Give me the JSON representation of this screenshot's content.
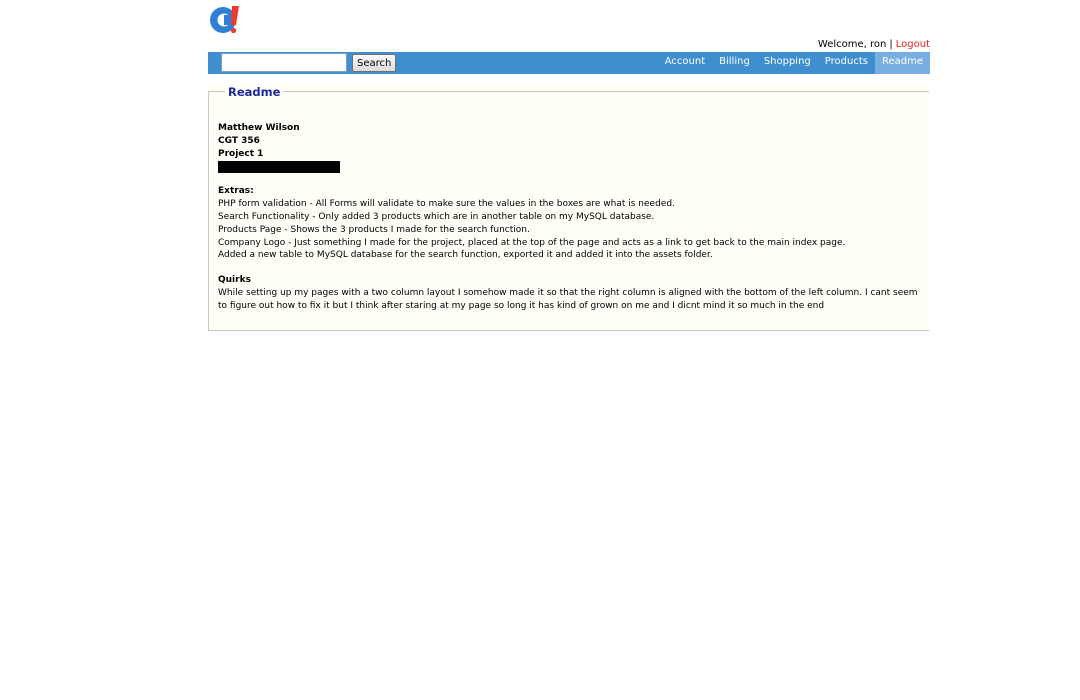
{
  "header": {
    "logo_alt": "logo-icon",
    "welcome_text": "Welcome, ron",
    "separator": "|",
    "logout_label": "Logout"
  },
  "search": {
    "value": "",
    "placeholder": "",
    "button_label": "Search"
  },
  "nav": {
    "items": [
      {
        "label": "Account"
      },
      {
        "label": "Billing"
      },
      {
        "label": "Shopping"
      },
      {
        "label": "Products"
      },
      {
        "label": "Readme"
      }
    ],
    "active": "Readme"
  },
  "readme": {
    "legend": "Readme",
    "author": "Matthew Wilson",
    "course": "CGT 356",
    "project": "Project 1",
    "extras_heading": "Extras:",
    "extras": [
      "PHP form validation - All Forms will validate to make sure the values in the boxes are what is needed.",
      "Search Functionality - Only added 3 products which are in another table on my MySQL database.",
      "Products Page - Shows the 3 products I made for the search function.",
      "Company Logo - Just something I made for the project, placed at the top of the page and acts as a link to get back to the main index page.",
      "Added a new table to MySQL database for the search function, exported it and added it into the assets folder."
    ],
    "quirks_heading": "Quirks",
    "quirks_text": "While setting up my pages with a two column layout I somehow made it so that the right column is aligned with the bottom of the left column. I cant seem to figure out how to fix it but I think after staring at my page so long it has kind of grown on me and I dicnt mind it so much in the end"
  },
  "colors": {
    "nav_bg": "#3f8fd0",
    "nav_active": "#78aee0",
    "legend": "#1a2a9c",
    "logout": "#e0241b",
    "content_bg": "#fffff7"
  }
}
